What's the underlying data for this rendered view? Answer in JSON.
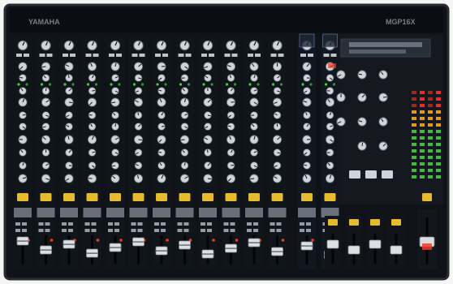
{
  "photo": {
    "subject": "mixing-console",
    "brand_logo_text": "YAMAHA",
    "model_logo_text": "MGP16X",
    "input_channel_count": 12,
    "stereo_channel_count": 2,
    "group_master_count": 4,
    "colors": {
      "panel": "#101318",
      "panel_edge": "#2a2e35",
      "knob": "#d9dde2",
      "strip_label": "#b9c3cf",
      "fader_cap": "#e7e9ea",
      "on_button": "#f2c330",
      "peak_led": "#ff3a2b",
      "level_led_green": "#4cd34a",
      "level_led_amber": "#ffb020",
      "stereo_in_accent": "#7aa7ff"
    }
  }
}
